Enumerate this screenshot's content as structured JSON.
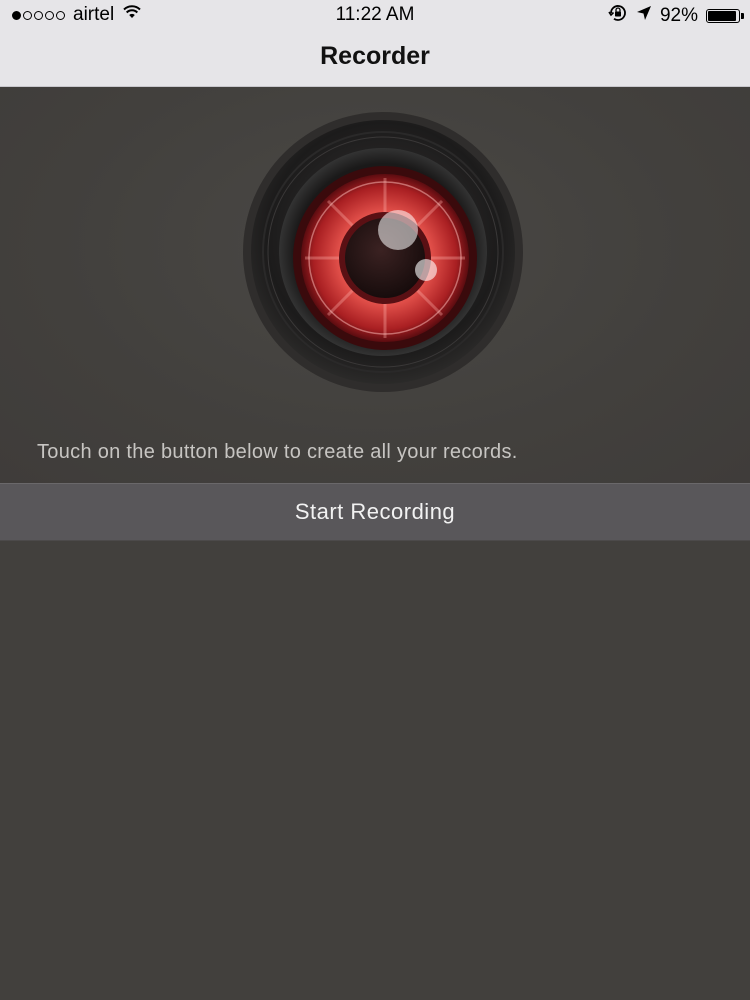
{
  "status_bar": {
    "signal_strength_filled": 1,
    "signal_strength_total": 5,
    "carrier": "airtel",
    "wifi_icon": "wifi-icon",
    "time": "11:22 AM",
    "orientation_lock_icon": "orientation-lock-icon",
    "location_icon": "location-arrow-icon",
    "battery_percent": "92%",
    "battery_level": 0.92
  },
  "navbar": {
    "title": "Recorder"
  },
  "hero": {
    "lens_icon": "camera-lens-icon",
    "hint": "Touch on the button below to create all your records."
  },
  "actions": {
    "start_recording_label": "Start Recording"
  },
  "colors": {
    "bar_background": "#e6e5e8",
    "app_background": "#42403d",
    "button_background": "#59575a",
    "lens_red": "#d8403f"
  }
}
